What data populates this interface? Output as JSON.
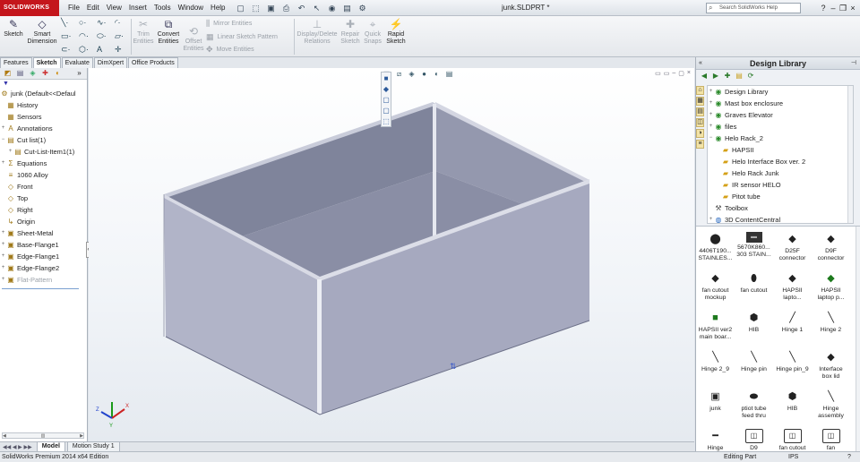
{
  "app": {
    "logo_text": "SOLIDWORKS",
    "menus": [
      "File",
      "Edit",
      "View",
      "Insert",
      "Tools",
      "Window",
      "Help"
    ],
    "document_title": "junk.SLDPRT *",
    "help_search_placeholder": "Search SolidWorks Help"
  },
  "command_manager": {
    "sketch": "Sketch",
    "smart_dimension_1": "Smart",
    "smart_dimension_2": "Dimension",
    "trim_1": "Trim",
    "trim_2": "Entities",
    "convert_1": "Convert",
    "convert_2": "Entities",
    "offset_1": "Offset",
    "offset_2": "Entities",
    "mirror": "Mirror Entities",
    "linear_pattern": "Linear Sketch Pattern",
    "move": "Move Entities",
    "display_delete_1": "Display/Delete",
    "display_delete_2": "Relations",
    "repair_1": "Repair",
    "repair_2": "Sketch",
    "quick_snaps_1": "Quick",
    "quick_snaps_2": "Snaps",
    "rapid_1": "Rapid",
    "rapid_2": "Sketch"
  },
  "tabs": [
    "Features",
    "Sketch",
    "Evaluate",
    "DimXpert",
    "Office Products"
  ],
  "active_tab": "Sketch",
  "feature_tree": {
    "root": "junk  (Default<<Defaul",
    "items": [
      {
        "label": "History",
        "icon": "history-icon",
        "glyph": "▦",
        "expand": ""
      },
      {
        "label": "Sensors",
        "icon": "sensors-icon",
        "glyph": "▦",
        "expand": ""
      },
      {
        "label": "Annotations",
        "icon": "annotations-icon",
        "glyph": "A",
        "expand": "+"
      },
      {
        "label": "Cut list(1)",
        "icon": "cut-list-icon",
        "glyph": "▤",
        "expand": "−"
      },
      {
        "label": "Cut-List-Item1(1)",
        "icon": "cut-list-item-icon",
        "glyph": "▤",
        "expand": "+",
        "indent": true
      },
      {
        "label": "Equations",
        "icon": "equations-icon",
        "glyph": "Σ",
        "expand": "+"
      },
      {
        "label": "1060 Alloy",
        "icon": "material-icon",
        "glyph": "≡",
        "expand": ""
      },
      {
        "label": "Front",
        "icon": "plane-icon",
        "glyph": "◇",
        "expand": ""
      },
      {
        "label": "Top",
        "icon": "plane-icon",
        "glyph": "◇",
        "expand": ""
      },
      {
        "label": "Right",
        "icon": "plane-icon",
        "glyph": "◇",
        "expand": ""
      },
      {
        "label": "Origin",
        "icon": "origin-icon",
        "glyph": "↳",
        "expand": ""
      },
      {
        "label": "Sheet-Metal",
        "icon": "sheet-metal-icon",
        "glyph": "▣",
        "expand": "+"
      },
      {
        "label": "Base-Flange1",
        "icon": "flange-icon",
        "glyph": "▣",
        "expand": "+"
      },
      {
        "label": "Edge-Flange1",
        "icon": "flange-icon",
        "glyph": "▣",
        "expand": "+"
      },
      {
        "label": "Edge-Flange2",
        "icon": "flange-icon",
        "glyph": "▣",
        "expand": "+"
      },
      {
        "label": "Flat-Pattern",
        "icon": "flat-pattern-icon",
        "glyph": "▣",
        "expand": "+",
        "dim": true
      }
    ]
  },
  "bottom_tabs": [
    "Model",
    "Motion Study 1"
  ],
  "status": {
    "edition": "SolidWorks Premium 2014 x64 Edition",
    "mode": "Editing Part",
    "units": "IPS",
    "help": "?"
  },
  "design_library": {
    "title": "Design Library",
    "tree": [
      {
        "label": "Design Library",
        "expand": "+",
        "folder": false
      },
      {
        "label": "Mast box enclosure",
        "expand": "+",
        "folder": false
      },
      {
        "label": "Graves Elevator",
        "expand": "+",
        "folder": false
      },
      {
        "label": "files",
        "expand": "+",
        "folder": false
      },
      {
        "label": "Helo Rack_2",
        "expand": "−",
        "folder": false
      },
      {
        "label": "HAPSII",
        "expand": "",
        "folder": true,
        "indent": true
      },
      {
        "label": "Helo Interface Box ver. 2",
        "expand": "",
        "folder": true,
        "indent": true
      },
      {
        "label": "Helo Rack Junk",
        "expand": "",
        "folder": true,
        "indent": true
      },
      {
        "label": "IR sensor HELO",
        "expand": "",
        "folder": true,
        "indent": true
      },
      {
        "label": "Pitot tube",
        "expand": "",
        "folder": true,
        "indent": true
      },
      {
        "label": "Toolbox",
        "expand": "",
        "folder": false,
        "tool": true
      },
      {
        "label": "3D ContentCentral",
        "expand": "+",
        "folder": false,
        "globe": true
      }
    ],
    "items": [
      {
        "l1": "4406T190...",
        "l2": "STAINLES...",
        "thumb": "⬤",
        "kind": ""
      },
      {
        "l1": "5670K860...",
        "l2": "303 STAIN...",
        "thumb": "▬",
        "kind": "dark"
      },
      {
        "l1": "D25F",
        "l2": "connector",
        "thumb": "◆",
        "kind": ""
      },
      {
        "l1": "D9F",
        "l2": "connector",
        "thumb": "◆",
        "kind": ""
      },
      {
        "l1": "fan cutout",
        "l2": "mockup",
        "thumb": "◆",
        "kind": ""
      },
      {
        "l1": "fan cutout",
        "l2": "",
        "thumb": "⬮",
        "kind": ""
      },
      {
        "l1": "HAPSII",
        "l2": "lapto...",
        "thumb": "◆",
        "kind": ""
      },
      {
        "l1": "HAPSII",
        "l2": "laptop p...",
        "thumb": "◆",
        "kind": "green"
      },
      {
        "l1": "HAPSII ver2",
        "l2": "main boar...",
        "thumb": "■",
        "kind": "green"
      },
      {
        "l1": "HIB",
        "l2": "",
        "thumb": "⬢",
        "kind": ""
      },
      {
        "l1": "Hinge 1",
        "l2": "",
        "thumb": "╱",
        "kind": ""
      },
      {
        "l1": "Hinge 2",
        "l2": "",
        "thumb": "╲",
        "kind": ""
      },
      {
        "l1": "Hinge 2_9",
        "l2": "",
        "thumb": "╲",
        "kind": ""
      },
      {
        "l1": "Hinge pin",
        "l2": "",
        "thumb": "╲",
        "kind": ""
      },
      {
        "l1": "Hinge pin_9",
        "l2": "",
        "thumb": "╲",
        "kind": ""
      },
      {
        "l1": "Interface",
        "l2": "box lid",
        "thumb": "◆",
        "kind": ""
      },
      {
        "l1": "junk",
        "l2": "",
        "thumb": "▣",
        "kind": ""
      },
      {
        "l1": "ptiot tube",
        "l2": "feed thru",
        "thumb": "⬬",
        "kind": ""
      },
      {
        "l1": "HIB",
        "l2": "",
        "thumb": "⬢",
        "kind": ""
      },
      {
        "l1": "Hinge",
        "l2": "assembly",
        "thumb": "╲",
        "kind": ""
      },
      {
        "l1": "Hinge",
        "l2": "",
        "thumb": "━",
        "kind": ""
      },
      {
        "l1": "D9",
        "l2": "",
        "thumb": "◫",
        "kind": "boxed"
      },
      {
        "l1": "fan cutout",
        "l2": "",
        "thumb": "◫",
        "kind": "boxed"
      },
      {
        "l1": "fan",
        "l2": "",
        "thumb": "◫",
        "kind": "boxed"
      }
    ]
  },
  "colors": {
    "model_top": "#b9bccd",
    "model_front": "#a7aac1",
    "model_inner": "#8d91a8",
    "logo_red": "#c4161c"
  },
  "triad": {
    "x": "X",
    "y": "Y",
    "z": "Z"
  }
}
